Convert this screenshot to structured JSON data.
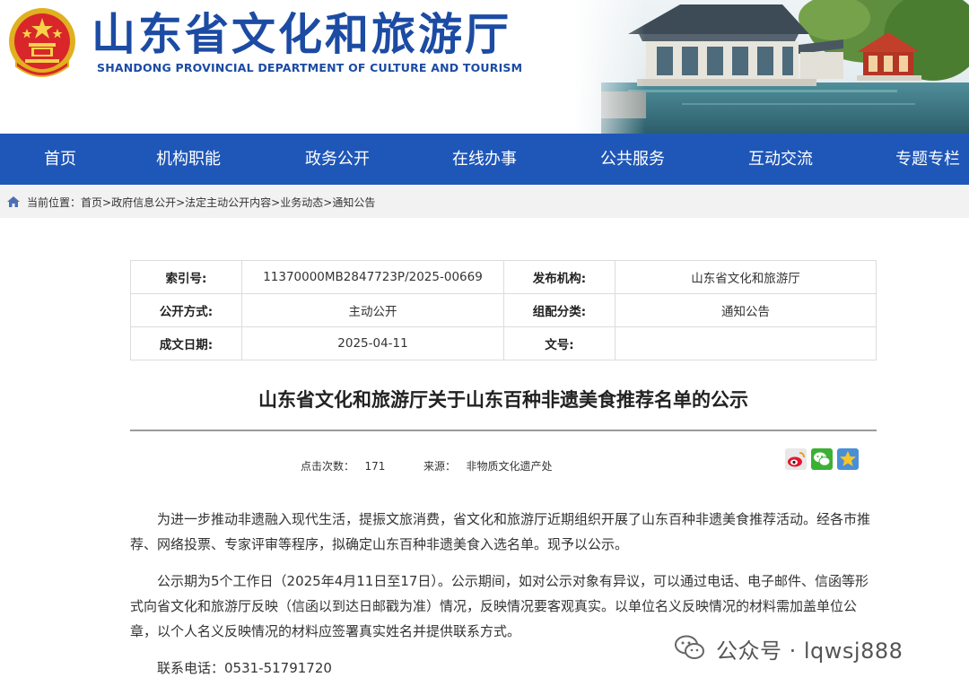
{
  "header": {
    "title": "山东省文化和旅游厅",
    "subtitle": "SHANDONG PROVINCIAL DEPARTMENT OF CULTURE AND  TOURISM"
  },
  "nav": [
    "首页",
    "机构职能",
    "政务公开",
    "在线办事",
    "公共服务",
    "互动交流",
    "专题专栏"
  ],
  "breadcrumb": {
    "label": "当前位置：",
    "items": [
      "首页",
      "政府信息公开",
      "法定主动公开内容",
      "业务动态",
      "通知公告"
    ],
    "sep": ">"
  },
  "meta": {
    "index_key": "索引号:",
    "index_val": "11370000MB2847723P/2025-00669",
    "publisher_key": "发布机构:",
    "publisher_val": "山东省文化和旅游厅",
    "mode_key": "公开方式:",
    "mode_val": "主动公开",
    "category_key": "组配分类:",
    "category_val": "通知公告",
    "date_key": "成文日期:",
    "date_val": "2025-04-11",
    "docno_key": "文号:",
    "docno_val": ""
  },
  "article": {
    "title": "山东省文化和旅游厅关于山东百种非遗美食推荐名单的公示",
    "clicks_label": "点击次数：",
    "clicks": "171",
    "source_label": "来源：",
    "source": "非物质文化遗产处",
    "para1": "为进一步推动非遗融入现代生活，提振文旅消费，省文化和旅游厅近期组织开展了山东百种非遗美食推荐活动。经各市推荐、网络投票、专家评审等程序，拟确定山东百种非遗美食入选名单。现予以公示。",
    "para2": "公示期为5个工作日（2025年4月11日至17日）。公示期间，如对公示对象有异议，可以通过电话、电子邮件、信函等形式向省文化和旅游厅反映（信函以到达日邮戳为准）情况，反映情况要客观真实。以单位名义反映情况的材料需加盖单位公章，以个人名义反映情况的材料应签署真实姓名并提供联系方式。",
    "contact": "联系电话：0531-51791720"
  },
  "watermark": "公众号 · lqwsj888",
  "colors": {
    "brand": "#1c4ba3",
    "nav_bg": "#1f57b8",
    "crumb_bg": "#f2f2f2"
  },
  "icons": {
    "share": [
      "weibo-icon",
      "wechat-icon",
      "favorite-star-icon"
    ],
    "emblem": "national-emblem",
    "crumb": "home-icon"
  }
}
